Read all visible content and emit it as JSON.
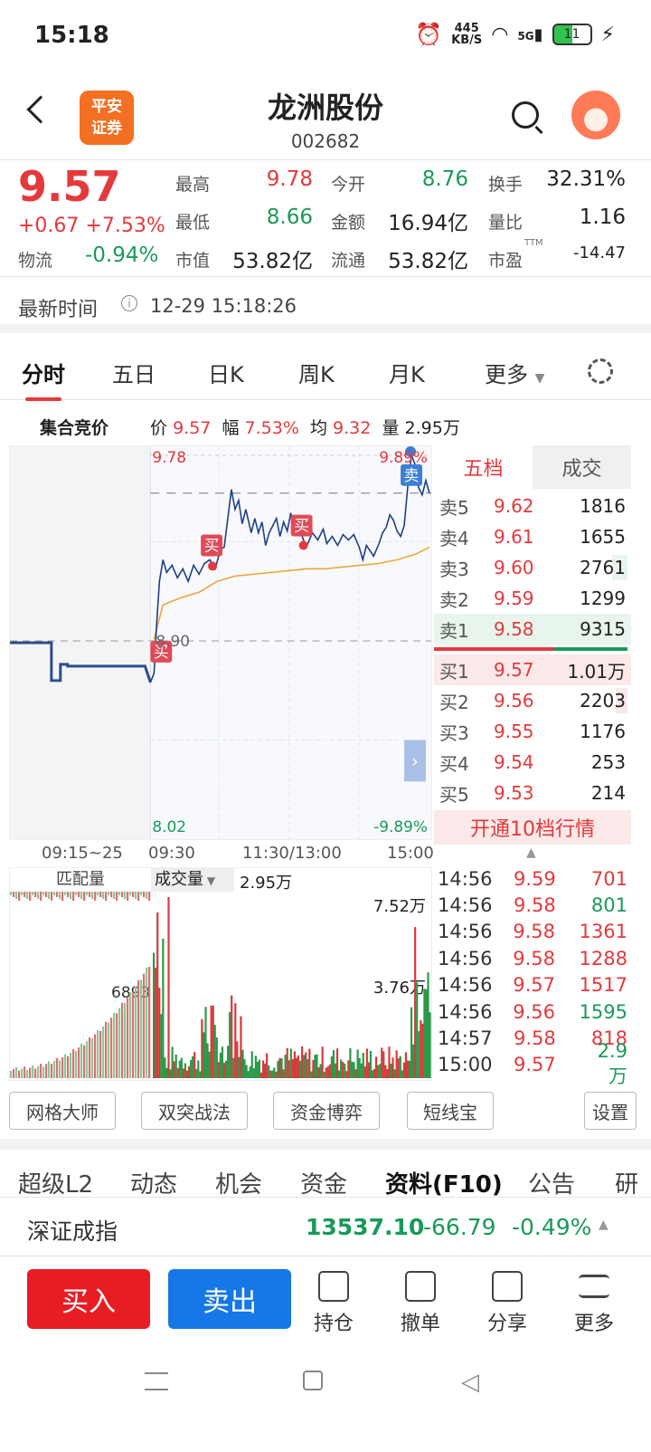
{
  "status": {
    "time": "15:18",
    "net_speed": "445",
    "net_unit": "KB/S",
    "signal": "5G",
    "battery": "11"
  },
  "header": {
    "logo": "平安\n证券",
    "stock_name": "龙洲股份",
    "stock_code": "002682"
  },
  "quote": {
    "price": "9.57",
    "change": "+0.67",
    "change_pct": "+7.53%",
    "sector_label": "物流",
    "sector_pct": "-0.94%",
    "cells": [
      {
        "label": "最高",
        "value": "9.78",
        "color": "red"
      },
      {
        "label": "今开",
        "value": "8.76",
        "color": "green"
      },
      {
        "label": "换手",
        "value": "32.31%",
        "color": "dark"
      },
      {
        "label": "最低",
        "value": "8.66",
        "color": "green"
      },
      {
        "label": "金额",
        "value": "16.94亿",
        "color": "dark"
      },
      {
        "label": "量比",
        "value": "1.16",
        "color": "dark"
      },
      {
        "label": "市值",
        "value": "53.82亿",
        "color": "dark"
      },
      {
        "label": "流通",
        "value": "53.82亿",
        "color": "dark"
      },
      {
        "label": "市盈",
        "value": "-14.47",
        "color": "dark",
        "sup": "TTM"
      }
    ]
  },
  "update": {
    "label": "最新时间",
    "value": "12-29 15:18:26"
  },
  "tabs": [
    "分时",
    "五日",
    "日K",
    "周K",
    "月K",
    "更多"
  ],
  "auction": {
    "label": "集合竞价",
    "price_label": "价",
    "price": "9.57",
    "range_label": "幅",
    "range": "7.53%",
    "avg_label": "均",
    "avg": "9.32",
    "vol_label": "量",
    "vol": "2.95万"
  },
  "chart_labels": {
    "high": "9.78",
    "high_pct": "9.89%",
    "mid": "8.90",
    "low": "8.02",
    "low_pct": "-9.89%",
    "buy": "买",
    "sell": "卖"
  },
  "axis": {
    "t0": "09:15~25",
    "t1": "09:30",
    "t2": "11:30/13:00",
    "t3": "15:00"
  },
  "orderbook": {
    "tab_active": "五档",
    "tab_other": "成交",
    "asks": [
      {
        "n": "卖5",
        "p": "9.62",
        "v": "1816",
        "w": 0.0
      },
      {
        "n": "卖4",
        "p": "9.61",
        "v": "1655",
        "w": 0.0
      },
      {
        "n": "卖3",
        "p": "9.60",
        "v": "2761",
        "w": 0.28
      },
      {
        "n": "卖2",
        "p": "9.59",
        "v": "1299",
        "w": 0.0
      },
      {
        "n": "卖1",
        "p": "9.58",
        "v": "9315",
        "w": 1.0
      }
    ],
    "bids": [
      {
        "n": "买1",
        "p": "9.57",
        "v": "1.01万",
        "w": 1.0
      },
      {
        "n": "买2",
        "p": "9.56",
        "v": "2203",
        "w": 0.22
      },
      {
        "n": "买3",
        "p": "9.55",
        "v": "1176",
        "w": 0.0
      },
      {
        "n": "买4",
        "p": "9.54",
        "v": "253",
        "w": 0.0
      },
      {
        "n": "买5",
        "p": "9.53",
        "v": "214",
        "w": 0.0
      }
    ],
    "open_label": "开通10档行情"
  },
  "volume": {
    "left_label": "匹配量",
    "sel_label": "成交量",
    "sel_val": "2.95万",
    "top": "7.52万",
    "mid": "3.76万",
    "auction_peak": "6893"
  },
  "ticks": [
    {
      "t": "14:56",
      "p": "9.59",
      "v": "701",
      "pc": "red",
      "vc": "red"
    },
    {
      "t": "14:56",
      "p": "9.58",
      "v": "801",
      "pc": "red",
      "vc": "green"
    },
    {
      "t": "14:56",
      "p": "9.58",
      "v": "1361",
      "pc": "red",
      "vc": "red"
    },
    {
      "t": "14:56",
      "p": "9.58",
      "v": "1288",
      "pc": "red",
      "vc": "red"
    },
    {
      "t": "14:56",
      "p": "9.57",
      "v": "1517",
      "pc": "red",
      "vc": "red"
    },
    {
      "t": "14:56",
      "p": "9.56",
      "v": "1595",
      "pc": "red",
      "vc": "green"
    },
    {
      "t": "14:57",
      "p": "9.58",
      "v": "818",
      "pc": "red",
      "vc": "red"
    },
    {
      "t": "15:00",
      "p": "9.57",
      "v": "2.9万",
      "pc": "red",
      "vc": "green"
    }
  ],
  "tools": [
    "网格大师",
    "双突战法",
    "资金博弈",
    "短线宝",
    "设置"
  ],
  "subtabs": [
    "超级L2",
    "动态",
    "机会",
    "资金",
    "资料(F10)",
    "公告",
    "研"
  ],
  "index": {
    "name": "深证成指",
    "value": "13537.10",
    "change": "-66.79",
    "pct": "-0.49%"
  },
  "bottom": {
    "buy": "买入",
    "sell": "卖出",
    "items": [
      "持仓",
      "撤单",
      "分享",
      "更多"
    ]
  },
  "colors": {
    "up": "#e4393c",
    "down": "#1a9a5a",
    "sell_btn": "#1677e6",
    "buy_btn": "#e81c23"
  }
}
